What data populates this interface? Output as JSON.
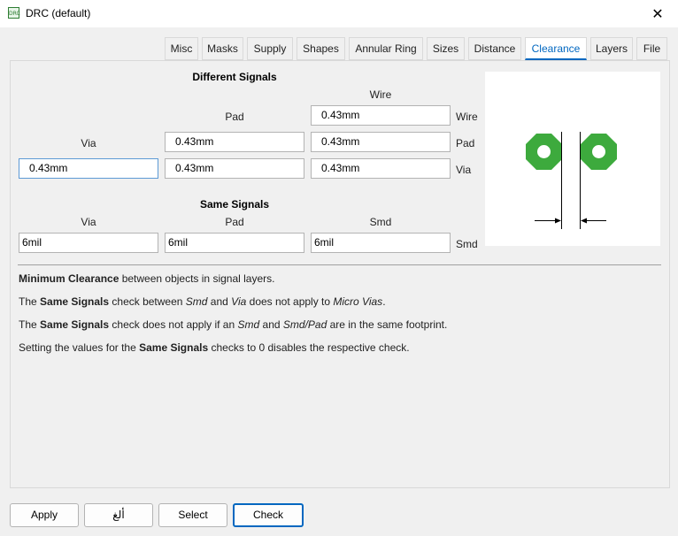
{
  "window": {
    "title": "DRC (default)",
    "app_icon_text": "DRC",
    "close_glyph": "✕"
  },
  "tabs": [
    "Misc",
    "Masks",
    "Supply",
    "Shapes",
    "Annular Ring",
    "Sizes",
    "Distance",
    "Clearance",
    "Layers",
    "File"
  ],
  "active_tab": "Clearance",
  "different_signals": {
    "heading": "Different Signals",
    "col_wire": "Wire",
    "col_pad": "Pad",
    "col_via": "Via",
    "row_wire": "Wire",
    "row_pad": "Pad",
    "row_via": "Via",
    "wire_wire": "0.43mm",
    "pad_pad": "0.43mm",
    "pad_wire": "0.43mm",
    "via_via": "0.43mm",
    "via_pad": "0.43mm",
    "via_wire": "0.43mm"
  },
  "same_signals": {
    "heading": "Same Signals",
    "col_via": "Via",
    "col_pad": "Pad",
    "col_smd": "Smd",
    "row_smd": "Smd",
    "via": "6mil",
    "pad": "6mil",
    "smd": "6mil"
  },
  "info": {
    "line1_bold": "Minimum Clearance",
    "line1_rest": " between objects in signal layers.",
    "line2_a": "The ",
    "line2_bold": "Same Signals",
    "line2_b": " check between ",
    "line2_smd": "Smd",
    "line2_and": " and ",
    "line2_via": "Via",
    "line2_c": " does not apply to ",
    "line2_micro": "Micro Vias",
    "line2_end": ".",
    "line3_a": "The ",
    "line3_bold": "Same Signals",
    "line3_b": " check does not apply if an ",
    "line3_smd": "Smd",
    "line3_and": " and ",
    "line3_smdpad": "Smd/Pad",
    "line3_c": " are in the same footprint.",
    "line4_a": "Setting the values for the ",
    "line4_bold": "Same Signals",
    "line4_b": " checks to 0 disables the respective check."
  },
  "buttons": {
    "apply": "Apply",
    "cancel": "ألغ",
    "select": "Select",
    "check": "Check"
  },
  "colors": {
    "accent": "#0067c0",
    "pad_green": "#3daa3d"
  }
}
